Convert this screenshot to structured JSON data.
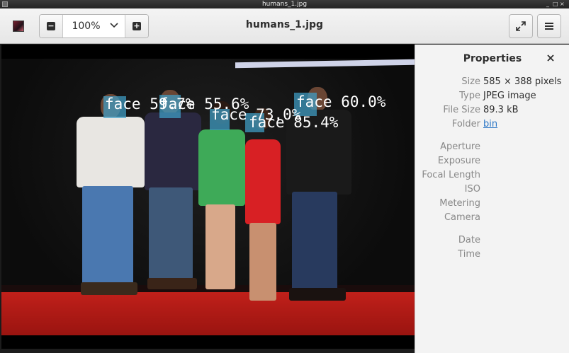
{
  "window": {
    "title": "humans_1.jpg"
  },
  "header": {
    "zoom_value": "100%",
    "file_title": "humans_1.jpg"
  },
  "detections": [
    {
      "label": "face 59.7%"
    },
    {
      "label": "face 55.6%"
    },
    {
      "label": "face 73.0%"
    },
    {
      "label": "face 85.4%"
    },
    {
      "label": "face 60.0%"
    }
  ],
  "properties": {
    "title": "Properties",
    "rows": [
      {
        "key": "Size",
        "value": "585 × 388 pixels"
      },
      {
        "key": "Type",
        "value": "JPEG image"
      },
      {
        "key": "File Size",
        "value": "89.3 kB"
      },
      {
        "key": "Folder",
        "value": "bin"
      },
      {
        "key": "Aperture",
        "value": ""
      },
      {
        "key": "Exposure",
        "value": ""
      },
      {
        "key": "Focal Length",
        "value": ""
      },
      {
        "key": "ISO",
        "value": ""
      },
      {
        "key": "Metering",
        "value": ""
      },
      {
        "key": "Camera",
        "value": ""
      },
      {
        "key": "Date",
        "value": ""
      },
      {
        "key": "Time",
        "value": ""
      }
    ]
  },
  "icons": [
    "gallery-thumbnail-icon",
    "zoom-out-icon",
    "chevron-down-icon",
    "zoom-in-icon",
    "fullscreen-icon",
    "hamburger-menu-icon",
    "close-icon"
  ],
  "colors": {
    "face_box": "#40a0c8",
    "link": "#2a76c6",
    "carpet": "#c0201a"
  }
}
